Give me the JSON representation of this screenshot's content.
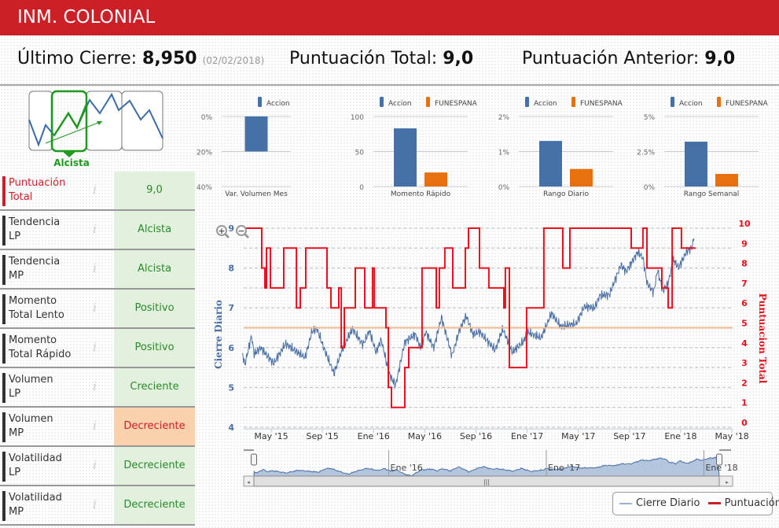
{
  "header": {
    "title": "INM. COLONIAL"
  },
  "metrics": {
    "last_close_label": "Último Cierre:",
    "last_close_value": "8,950",
    "last_close_date": "(02/02/2018)",
    "total_label": "Puntuación Total:",
    "total_value": "9,0",
    "prev_label": "Puntuación Anterior:",
    "prev_value": "9,0"
  },
  "trend_icon": {
    "label": "Alcista",
    "color": "#1f9a1f"
  },
  "rows": [
    {
      "label1": "Puntuación",
      "label2": "Total",
      "value": "9,0",
      "status": "good",
      "highlight": true
    },
    {
      "label1": "Tendencia",
      "label2": "LP",
      "value": "Alcista",
      "status": "good"
    },
    {
      "label1": "Tendencia",
      "label2": "MP",
      "value": "Alcista",
      "status": "good"
    },
    {
      "label1": "Momento",
      "label2": "Total Lento",
      "value": "Positivo",
      "status": "good"
    },
    {
      "label1": "Momento",
      "label2": "Total Rápido",
      "value": "Positivo",
      "status": "good"
    },
    {
      "label1": "Volumen",
      "label2": "LP",
      "value": "Creciente",
      "status": "good"
    },
    {
      "label1": "Volumen",
      "label2": "MP",
      "value": "Decreciente",
      "status": "bad"
    },
    {
      "label1": "Volatilidad",
      "label2": "LP",
      "value": "Decreciente",
      "status": "good"
    },
    {
      "label1": "Volatilidad",
      "label2": "MP",
      "value": "Decreciente",
      "status": "good"
    }
  ],
  "colors": {
    "accion": "#4570a8",
    "funespana": "#e8700f",
    "price": "#4a6fa5",
    "score": "#e8101e",
    "ref": "#f0b890",
    "brand": "#cc1f26"
  },
  "chart_data": [
    {
      "type": "bar",
      "title": "Var. Volumen Mes",
      "legend": [
        "Accion"
      ],
      "ticks": [
        "0%",
        "-20%",
        "-40%"
      ],
      "ylim": [
        -40,
        0
      ],
      "values": [
        -20
      ]
    },
    {
      "type": "bar",
      "title": "Momento Rápido",
      "legend": [
        "Accion",
        "FUNESPANA"
      ],
      "ticks": [
        "100",
        "50",
        "0"
      ],
      "ylim": [
        0,
        100
      ],
      "values": [
        83,
        20
      ]
    },
    {
      "type": "bar",
      "title": "Rango Diario",
      "legend": [
        "Accion",
        "FUNESPANA"
      ],
      "ticks": [
        "2%",
        "1%",
        "0%"
      ],
      "ylim": [
        0,
        2
      ],
      "values": [
        1.3,
        0.5
      ]
    },
    {
      "type": "bar",
      "title": "Rango Semanal",
      "legend": [
        "Accion",
        "FUNESPANA"
      ],
      "ticks": [
        "5%",
        "2.5%",
        "0%"
      ],
      "ylim": [
        0,
        5
      ],
      "values": [
        3.2,
        0.9
      ]
    },
    {
      "type": "line",
      "x_unit": "months since Jan 2015",
      "ylabel_left": "Cierre Diario",
      "ylabel_right": "Puntuacion Total",
      "ylim_left": [
        4,
        9
      ],
      "ylim_right": [
        0,
        10
      ],
      "left_ticks": [
        "4",
        "5",
        "6",
        "7",
        "8",
        "9"
      ],
      "right_ticks": [
        "0",
        "1",
        "2",
        "3",
        "4",
        "5",
        "6",
        "7",
        "8",
        "9",
        "10"
      ],
      "x_ticks": [
        {
          "t": 4,
          "label": "May '15"
        },
        {
          "t": 8,
          "label": "Sep '15"
        },
        {
          "t": 12,
          "label": "Ene '16"
        },
        {
          "t": 16,
          "label": "May '16"
        },
        {
          "t": 20,
          "label": "Sep '16"
        },
        {
          "t": 24,
          "label": "Ene '17"
        },
        {
          "t": 28,
          "label": "May '17"
        },
        {
          "t": 32,
          "label": "Sep '17"
        },
        {
          "t": 36,
          "label": "Ene '18"
        },
        {
          "t": 40,
          "label": "May '18"
        }
      ],
      "reference_score": 5,
      "series": [
        {
          "name": "Cierre Diario",
          "axis": "left",
          "points": [
            [
              1.75,
              5.84
            ],
            [
              1.95,
              5.58
            ],
            [
              2.46,
              6.3
            ],
            [
              2.67,
              5.84
            ],
            [
              3.18,
              6.0
            ],
            [
              4.2,
              5.6
            ],
            [
              5.12,
              6.1
            ],
            [
              6.05,
              5.88
            ],
            [
              6.66,
              5.75
            ],
            [
              7.18,
              6.4
            ],
            [
              7.58,
              6.47
            ],
            [
              8.1,
              6.0
            ],
            [
              8.91,
              5.35
            ],
            [
              9.53,
              5.94
            ],
            [
              10.35,
              6.47
            ],
            [
              11.17,
              6.07
            ],
            [
              11.68,
              6.43
            ],
            [
              12.19,
              5.88
            ],
            [
              12.6,
              6.2
            ],
            [
              13.21,
              5.35
            ],
            [
              13.72,
              5.05
            ],
            [
              14.44,
              6.14
            ],
            [
              15.26,
              6.34
            ],
            [
              15.67,
              6.0
            ],
            [
              16.08,
              6.4
            ],
            [
              16.7,
              6.0
            ],
            [
              17.31,
              6.76
            ],
            [
              18.13,
              5.8
            ],
            [
              18.74,
              6.47
            ],
            [
              19.25,
              6.8
            ],
            [
              19.77,
              6.33
            ],
            [
              20.28,
              6.4
            ],
            [
              21.5,
              5.94
            ],
            [
              22.1,
              6.47
            ],
            [
              22.84,
              5.88
            ],
            [
              23.76,
              6.17
            ],
            [
              23.96,
              6.4
            ],
            [
              25.09,
              6.24
            ],
            [
              25.9,
              6.86
            ],
            [
              26.62,
              6.53
            ],
            [
              27.85,
              6.6
            ],
            [
              28.46,
              7.03
            ],
            [
              29.28,
              7.0
            ],
            [
              29.69,
              7.32
            ],
            [
              30.41,
              7.32
            ],
            [
              31.33,
              8.08
            ],
            [
              31.74,
              7.91
            ],
            [
              32.66,
              8.41
            ],
            [
              33.06,
              8.24
            ],
            [
              33.37,
              7.62
            ],
            [
              33.89,
              7.39
            ],
            [
              34.19,
              7.95
            ],
            [
              34.6,
              7.42
            ],
            [
              35.02,
              7.62
            ],
            [
              35.43,
              8.21
            ],
            [
              35.84,
              8.01
            ],
            [
              36.45,
              8.41
            ],
            [
              36.87,
              8.51
            ],
            [
              37.07,
              8.8
            ]
          ]
        },
        {
          "name": "Puntuación",
          "axis": "right",
          "step": true,
          "points": [
            [
              1.73,
              10
            ],
            [
              3.26,
              8
            ],
            [
              3.51,
              7
            ],
            [
              3.63,
              9
            ],
            [
              3.94,
              7
            ],
            [
              4.98,
              9
            ],
            [
              5.97,
              6
            ],
            [
              6.27,
              7
            ],
            [
              6.7,
              9
            ],
            [
              8.36,
              7
            ],
            [
              8.67,
              6
            ],
            [
              9.28,
              7
            ],
            [
              9.47,
              4
            ],
            [
              9.71,
              6
            ],
            [
              10.57,
              8
            ],
            [
              11.31,
              6
            ],
            [
              11.92,
              8
            ],
            [
              12.05,
              6
            ],
            [
              12.97,
              5
            ],
            [
              13.15,
              2
            ],
            [
              13.4,
              1
            ],
            [
              14.44,
              3
            ],
            [
              14.75,
              4
            ],
            [
              15.79,
              8
            ],
            [
              16.9,
              6
            ],
            [
              17.14,
              8
            ],
            [
              17.57,
              9
            ],
            [
              18.19,
              7
            ],
            [
              19.17,
              9
            ],
            [
              19.42,
              10
            ],
            [
              20.28,
              8
            ],
            [
              21.01,
              7
            ],
            [
              22.18,
              6
            ],
            [
              22.3,
              8
            ],
            [
              22.61,
              3
            ],
            [
              23.96,
              6
            ],
            [
              25.31,
              10
            ],
            [
              26.79,
              8
            ],
            [
              27.34,
              10
            ],
            [
              32.13,
              9
            ],
            [
              33.05,
              10
            ],
            [
              33.36,
              8
            ],
            [
              34.53,
              7
            ],
            [
              35.02,
              6
            ],
            [
              35.33,
              10
            ],
            [
              36.06,
              9
            ],
            [
              37.17,
              9
            ]
          ]
        }
      ],
      "navigator": {
        "labels": [
          {
            "t": 12,
            "label": "Ene '16"
          },
          {
            "t": 24,
            "label": "Ene '17"
          },
          {
            "t": 36,
            "label": "Ene '18"
          }
        ]
      },
      "legend": [
        "Cierre Diario",
        "Puntuación"
      ]
    }
  ]
}
